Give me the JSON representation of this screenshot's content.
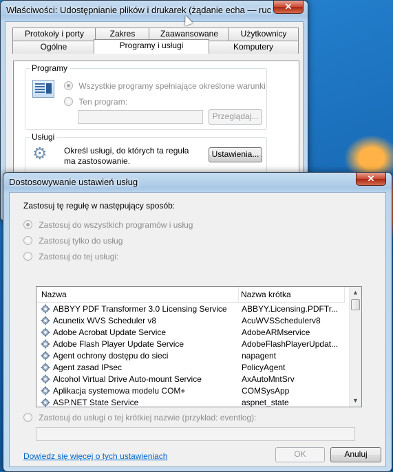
{
  "back_window": {
    "title": "Właściwości: Udostępnianie plików i drukarek (żądanie echa — ruch pr...",
    "close": "✕",
    "tabs_row1": [
      "Protokoły i porty",
      "Zakres",
      "Zaawansowane",
      "Użytkownicy"
    ],
    "tabs_row2": [
      "Ogólne",
      "Programy i usługi",
      "Komputery"
    ],
    "programs_group": {
      "label": "Programy",
      "opt_all": "Wszystkie programy spełniające określone warunki",
      "opt_this": "Ten program:",
      "browse": "Przeglądaj..."
    },
    "services_group": {
      "label": "Usługi",
      "desc": "Określ usługi, do których ta reguła ma zastosowanie.",
      "settings": "Ustawienia..."
    }
  },
  "dialog": {
    "title": "Dostosowywanie ustawień usług",
    "close": "✕",
    "apply_label": "Zastosuj tę regułę w następujący sposób:",
    "opt_all": "Zastosuj do wszystkich programów i usług",
    "opt_services_only": "Zastosuj tylko do usług",
    "opt_this_service": "Zastosuj do tej usługi:",
    "opt_short_name": "Zastosuj do usługi o tej krótkiej nazwie (przykład: eventlog):",
    "columns": {
      "name": "Nazwa",
      "short": "Nazwa krótka"
    },
    "services": [
      {
        "name": "ABBYY PDF Transformer 3.0 Licensing Service",
        "short": "ABBYY.Licensing.PDFTr..."
      },
      {
        "name": "Acunetix WVS Scheduler v8",
        "short": "AcuWVSSchedulerv8"
      },
      {
        "name": "Adobe Acrobat Update Service",
        "short": "AdobeARMservice"
      },
      {
        "name": "Adobe Flash Player Update Service",
        "short": "AdobeFlashPlayerUpdat..."
      },
      {
        "name": "Agent ochrony dostępu do sieci",
        "short": "napagent"
      },
      {
        "name": "Agent zasad IPsec",
        "short": "PolicyAgent"
      },
      {
        "name": "Alcohol Virtual Drive Auto-mount Service",
        "short": "AxAutoMntSrv"
      },
      {
        "name": "Aplikacja systemowa modelu COM+",
        "short": "COMSysApp"
      },
      {
        "name": "ASP.NET State Service",
        "short": "aspnet_state"
      }
    ],
    "learn_more": "Dowiedz się więcej o tych ustawieniach",
    "ok": "OK",
    "cancel": "Anuluj"
  }
}
